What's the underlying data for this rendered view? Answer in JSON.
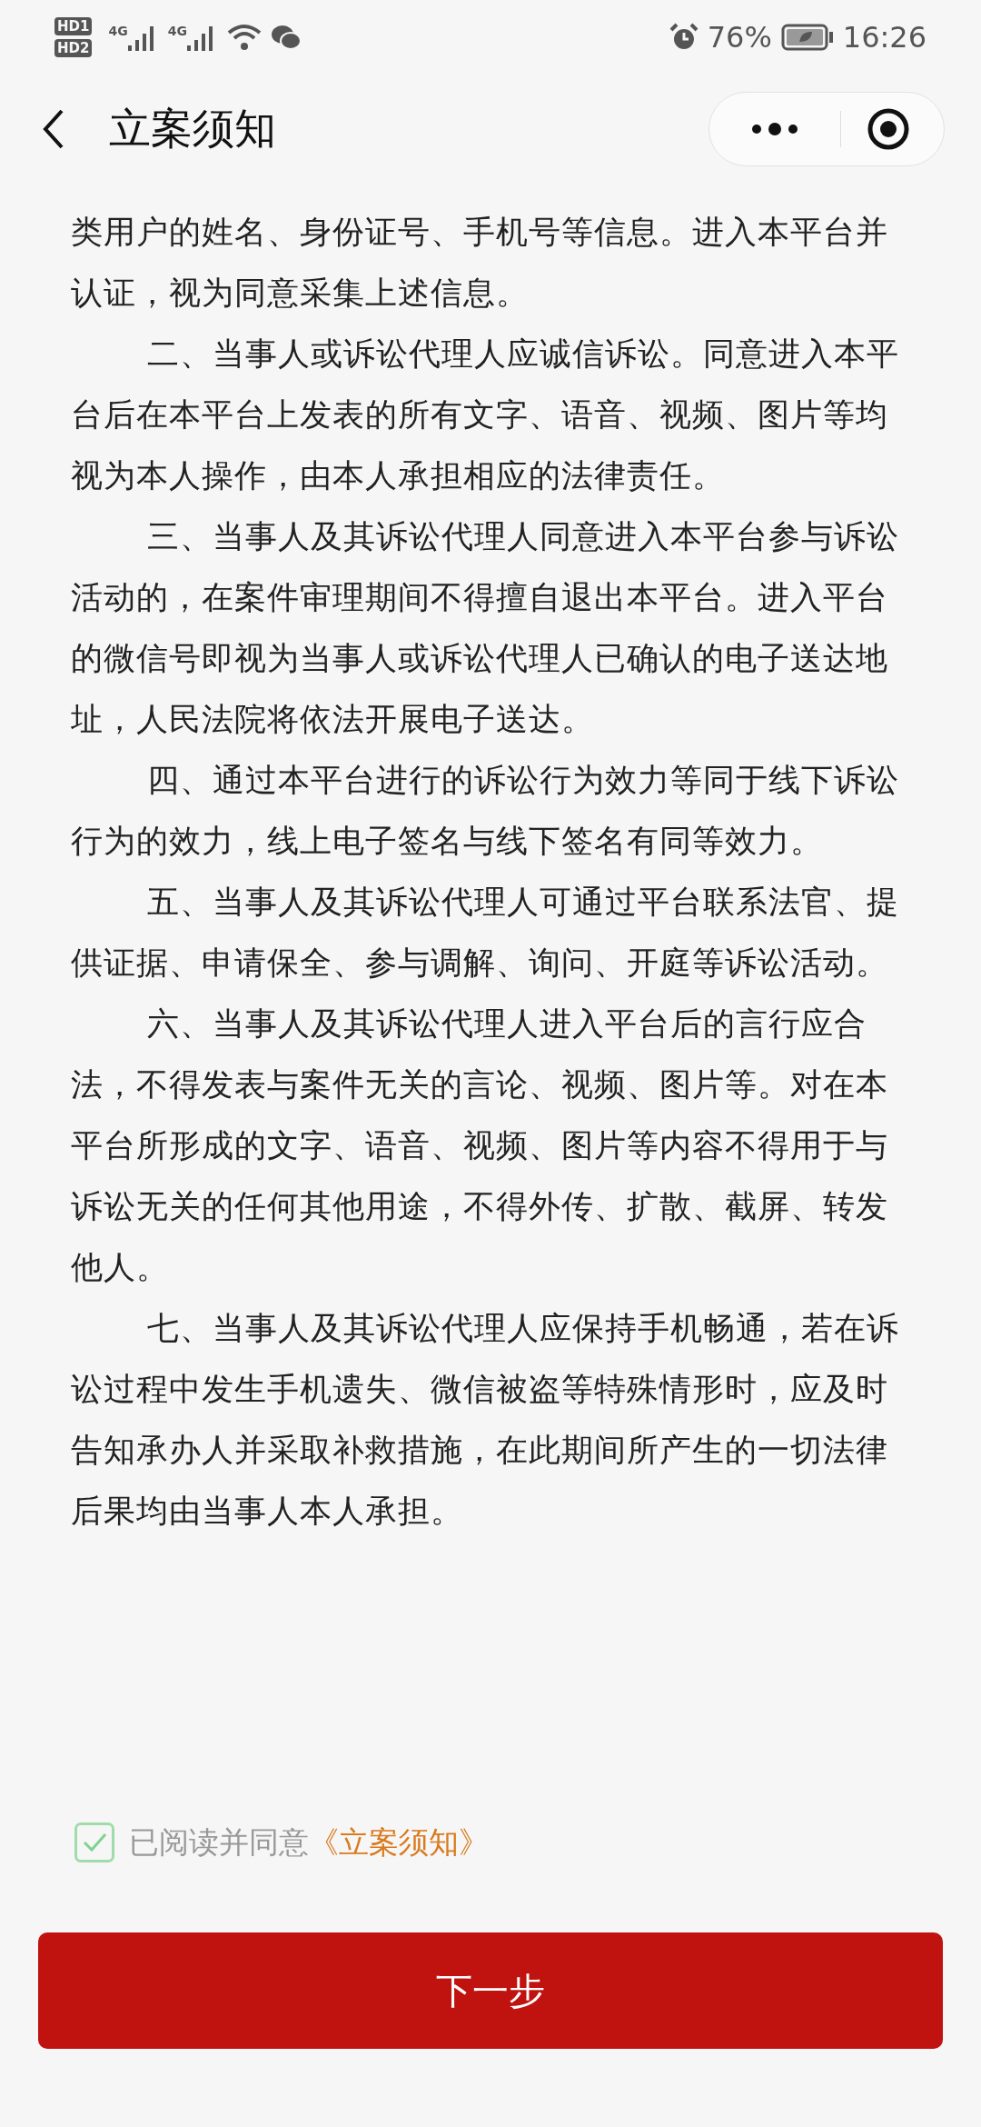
{
  "status_bar": {
    "sims": [
      "HD1",
      "HD2"
    ],
    "networks": [
      "4G",
      "4G"
    ],
    "battery_text": "76%",
    "time": "16:26"
  },
  "header": {
    "title": "立案须知"
  },
  "paragraphs": [
    {
      "text": "类用户的姓名、身份证号、手机号等信息。进入本平台并认证，视为同意采集上述信息。",
      "continued": true
    },
    {
      "text": "二、当事人或诉讼代理人应诚信诉讼。同意进入本平台后在本平台上发表的所有文字、语音、视频、图片等均视为本人操作，由本人承担相应的法律责任。",
      "continued": false
    },
    {
      "text": "三、当事人及其诉讼代理人同意进入本平台参与诉讼活动的，在案件审理期间不得擅自退出本平台。进入平台的微信号即视为当事人或诉讼代理人已确认的电子送达地址，人民法院将依法开展电子送达。",
      "continued": false
    },
    {
      "text": "四、通过本平台进行的诉讼行为效力等同于线下诉讼行为的效力，线上电子签名与线下签名有同等效力。",
      "continued": false
    },
    {
      "text": "五、当事人及其诉讼代理人可通过平台联系法官、提供证据、申请保全、参与调解、询问、开庭等诉讼活动。",
      "continued": false
    },
    {
      "text": "六、当事人及其诉讼代理人进入平台后的言行应合法，不得发表与案件无关的言论、视频、图片等。对在本平台所形成的文字、语音、视频、图片等内容不得用于与诉讼无关的任何其他用途，不得外传、扩散、截屏、转发他人。",
      "continued": false
    },
    {
      "text": "七、当事人及其诉讼代理人应保持手机畅通，若在诉讼过程中发生手机遗失、微信被盗等特殊情形时，应及时告知承办人并采取补救措施，在此期间所产生的一切法律后果均由当事人本人承担。",
      "continued": false
    }
  ],
  "agreement": {
    "checked": true,
    "label": "已阅读并同意",
    "link": "《立案须知》"
  },
  "next_button": "下一步"
}
